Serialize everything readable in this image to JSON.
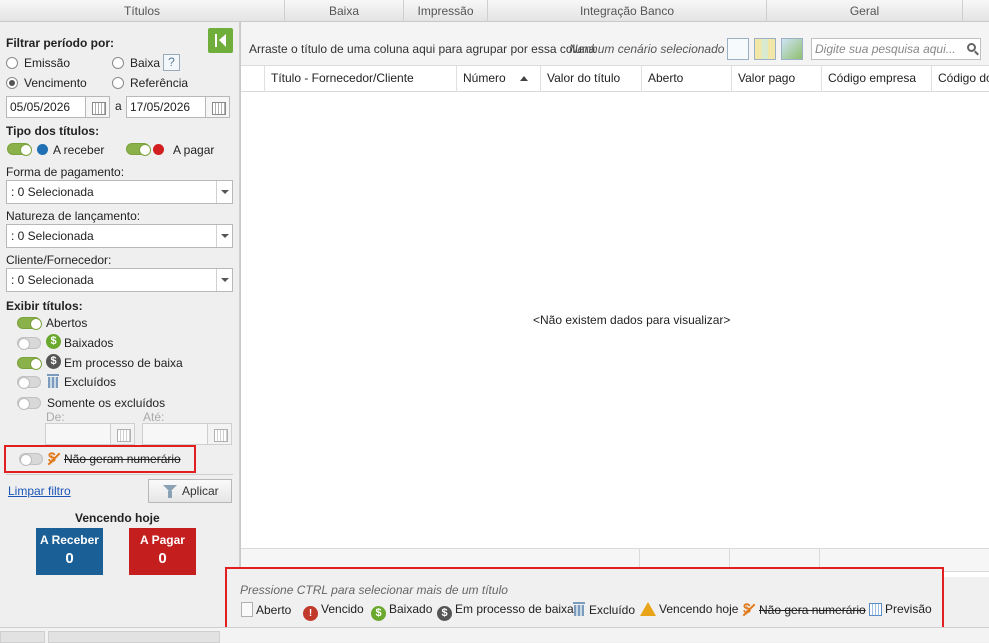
{
  "menu_tabs": [
    "Títulos",
    "Baixa",
    "Impressão",
    "Integração Banco",
    "Geral"
  ],
  "filter": {
    "period_title": "Filtrar período por:",
    "period_options": [
      "Emissão",
      "Baixa",
      "Vencimento",
      "Referência"
    ],
    "period_selected": "Vencimento",
    "help_label": "?",
    "date_from": "05/05/2026",
    "date_sep": "a",
    "date_to": "17/05/2026",
    "type_title": "Tipo dos títulos:",
    "type_receber": "A receber",
    "type_pagar": "A pagar",
    "payment_title": "Forma de pagamento:",
    "payment_value": ": 0 Selecionada",
    "nature_title": "Natureza de lançamento:",
    "nature_value": ": 0 Selecionada",
    "client_title": "Cliente/Fornecedor:",
    "client_value": ": 0 Selecionada",
    "show_title": "Exibir títulos:",
    "show_abertos": "Abertos",
    "show_baixados": "Baixados",
    "show_processo": "Em processo de baixa",
    "show_excluidos": "Excluídos",
    "show_somente": "Somente os excluídos",
    "de_label": "De:",
    "ate_label": "Até:",
    "nao_geram": "Não geram numerário",
    "limpar": "Limpar filtro",
    "aplicar": "Aplicar",
    "coin_symbol": "$"
  },
  "vencendo": {
    "title": "Vencendo hoje",
    "receber_label": "A Receber",
    "receber_value": "0",
    "pagar_label": "A Pagar",
    "pagar_value": "0"
  },
  "grid": {
    "group_hint": "Arraste o título de uma coluna aqui para agrupar por essa coluna",
    "scenario": "Nenhum cenário selecionado",
    "search_placeholder": "Digite sua pesquisa aqui...",
    "columns": [
      "Título - Fornecedor/Cliente",
      "Número",
      "Valor do título",
      "Aberto",
      "Valor pago",
      "Código empresa",
      "Código do"
    ],
    "empty": "<Não existem dados para visualizar>"
  },
  "legend": {
    "hint": "Pressione CTRL para selecionar mais de um título",
    "items": [
      "Aberto",
      "Vencido",
      "Baixado",
      "Em processo de baixa",
      "Excluído",
      "Vencendo hoje",
      "Não gera numerário",
      "Previsão"
    ],
    "vencido_symbol": "!",
    "coin_symbol": "$"
  },
  "colors": {
    "receber_dot": "#1f6fb5",
    "pagar_dot": "#d11f1f",
    "tile_receber": "#1a5f96",
    "tile_pagar": "#c41e1e",
    "toggle_on": "#8bb24a",
    "highlight": "#e02020"
  }
}
